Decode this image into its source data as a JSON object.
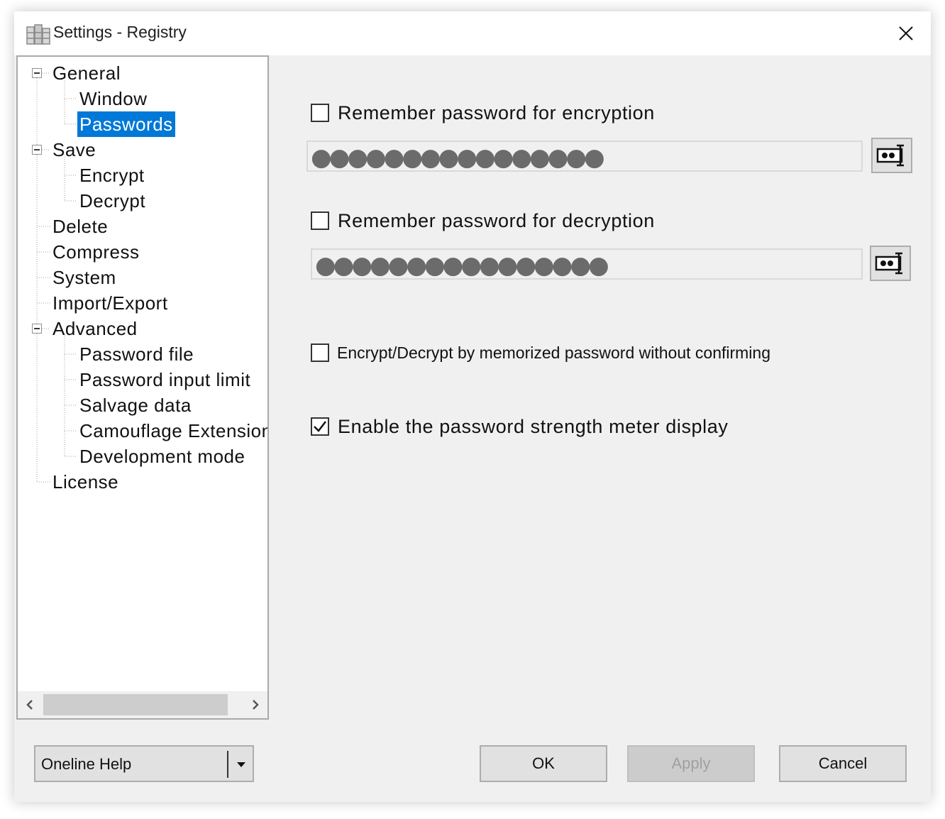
{
  "window": {
    "title": "Settings - Registry"
  },
  "tree": {
    "items": [
      {
        "label": "General"
      },
      {
        "label": "Window"
      },
      {
        "label": "Passwords",
        "selected": true
      },
      {
        "label": "Save"
      },
      {
        "label": "Encrypt"
      },
      {
        "label": "Decrypt"
      },
      {
        "label": "Delete"
      },
      {
        "label": "Compress"
      },
      {
        "label": "System"
      },
      {
        "label": "Import/Export"
      },
      {
        "label": "Advanced"
      },
      {
        "label": "Password file"
      },
      {
        "label": "Password input limit"
      },
      {
        "label": "Salvage data"
      },
      {
        "label": "Camouflage Extension"
      },
      {
        "label": "Development mode"
      },
      {
        "label": "License"
      }
    ]
  },
  "passwords": {
    "encrypt": {
      "label": "Remember password for encryption",
      "checked": false,
      "masked": "●●●●●●●●●●●●●●●●"
    },
    "decrypt": {
      "label": "Remember password for decryption",
      "checked": false,
      "masked": "●●●●●●●●●●●●●●●●"
    },
    "no_confirm": {
      "label": "Encrypt/Decrypt by memorized password without confirming",
      "checked": false
    },
    "strength_meter": {
      "label": "Enable the password strength meter display",
      "checked": true
    }
  },
  "footer": {
    "help_combo": "Oneline Help",
    "ok": "OK",
    "apply": "Apply",
    "cancel": "Cancel"
  },
  "colors": {
    "selection": "#0078d7",
    "window_bg": "#f0f0f0",
    "button_bg": "#e1e1e1"
  }
}
